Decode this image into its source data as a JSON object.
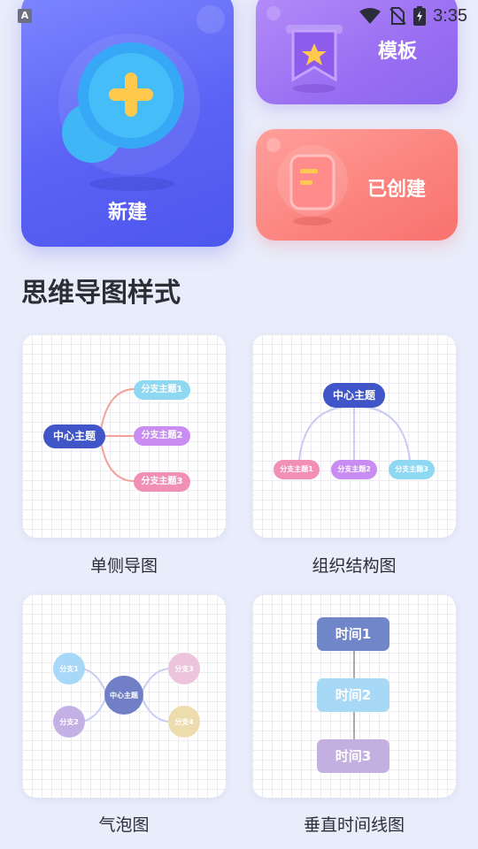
{
  "status_bar": {
    "app_badge": "A",
    "time": "3:35"
  },
  "cards": {
    "new_label": "新建",
    "templates_label": "模板",
    "created_label": "已创建"
  },
  "section_title": "思维导图样式",
  "styles": {
    "one_sided": {
      "label": "单侧导图",
      "center": "中心主题",
      "branches": [
        "分支主题1",
        "分支主题2",
        "分支主题3"
      ]
    },
    "org_chart": {
      "label": "组织结构图",
      "center": "中心主题",
      "branches": [
        "分支主题1",
        "分支主题2",
        "分支主题3"
      ]
    },
    "bubble": {
      "label": "气泡图",
      "center": "中心主题",
      "branches": [
        "分支1",
        "分支2",
        "分支3",
        "分支4"
      ]
    },
    "timeline": {
      "label": "垂直时间线图",
      "items": [
        "时间1",
        "时间2",
        "时间3"
      ]
    }
  },
  "colors": {
    "accent_blue": "#3f55c8",
    "branch_cyan": "#8fd8f2",
    "branch_purple": "#c88cf2",
    "branch_pink": "#f28fb5"
  }
}
